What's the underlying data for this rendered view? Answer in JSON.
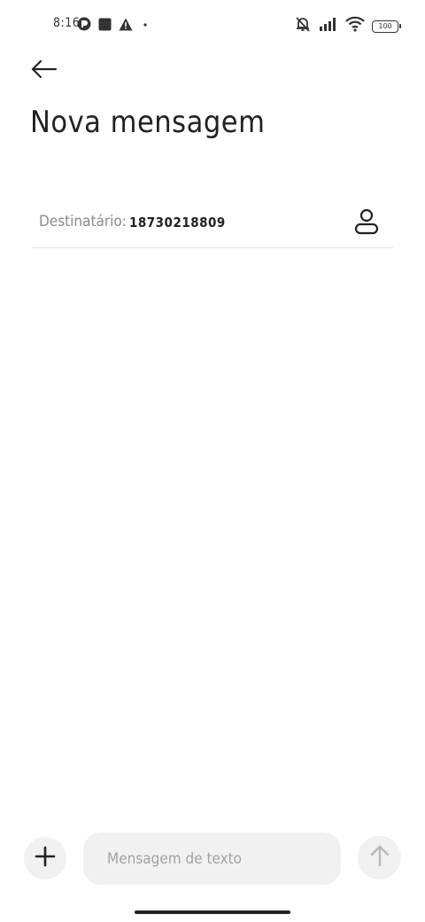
{
  "status_bar": {
    "time": "8:16",
    "battery_level": "100",
    "icons": [
      "app-notification-icon",
      "stop-square-icon",
      "warning-icon",
      "dot-icon",
      "mute-vibrate-icon",
      "signal-icon",
      "wifi-icon",
      "battery-icon"
    ]
  },
  "header": {
    "back_icon": "arrow-left-icon",
    "title": "Nova mensagem"
  },
  "recipient": {
    "label": "Destinatário:",
    "value": "18730218809",
    "contact_icon": "person-icon"
  },
  "composer": {
    "attach_icon": "plus-icon",
    "placeholder": "Mensagem de texto",
    "value": "",
    "send_icon": "arrow-up-icon"
  },
  "colors": {
    "background": "#ffffff",
    "text": "#222222",
    "muted_text": "#8a8a8a",
    "control_bg": "#f1f1f1",
    "disabled_icon": "#b8b8b8"
  }
}
